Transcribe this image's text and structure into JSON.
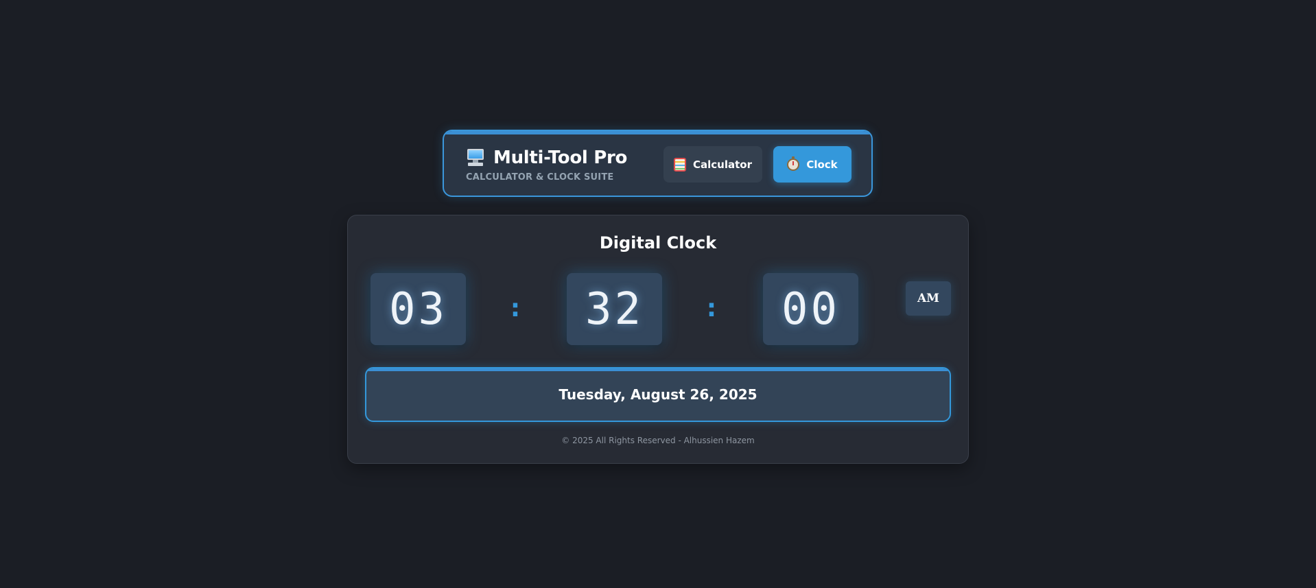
{
  "header": {
    "title": "Multi-Tool Pro",
    "subtitle": "CALCULATOR & CLOCK SUITE",
    "logo_icon": "computer-monitor-icon",
    "tabs": [
      {
        "label": "Calculator",
        "icon": "abacus-icon",
        "active": false
      },
      {
        "label": "Clock",
        "icon": "stopwatch-icon",
        "active": true
      }
    ]
  },
  "clock": {
    "title": "Digital Clock",
    "hours": "03",
    "minutes": "32",
    "seconds": "00",
    "separator": ":",
    "period": "AM",
    "date": "Tuesday, August 26, 2025"
  },
  "footer": {
    "text": "© 2025 All Rights Reserved - Alhussien Hazem"
  },
  "colors": {
    "background": "#1b1e25",
    "accent": "#3498db",
    "card": "#272b34",
    "digit_box": "#33475e"
  }
}
